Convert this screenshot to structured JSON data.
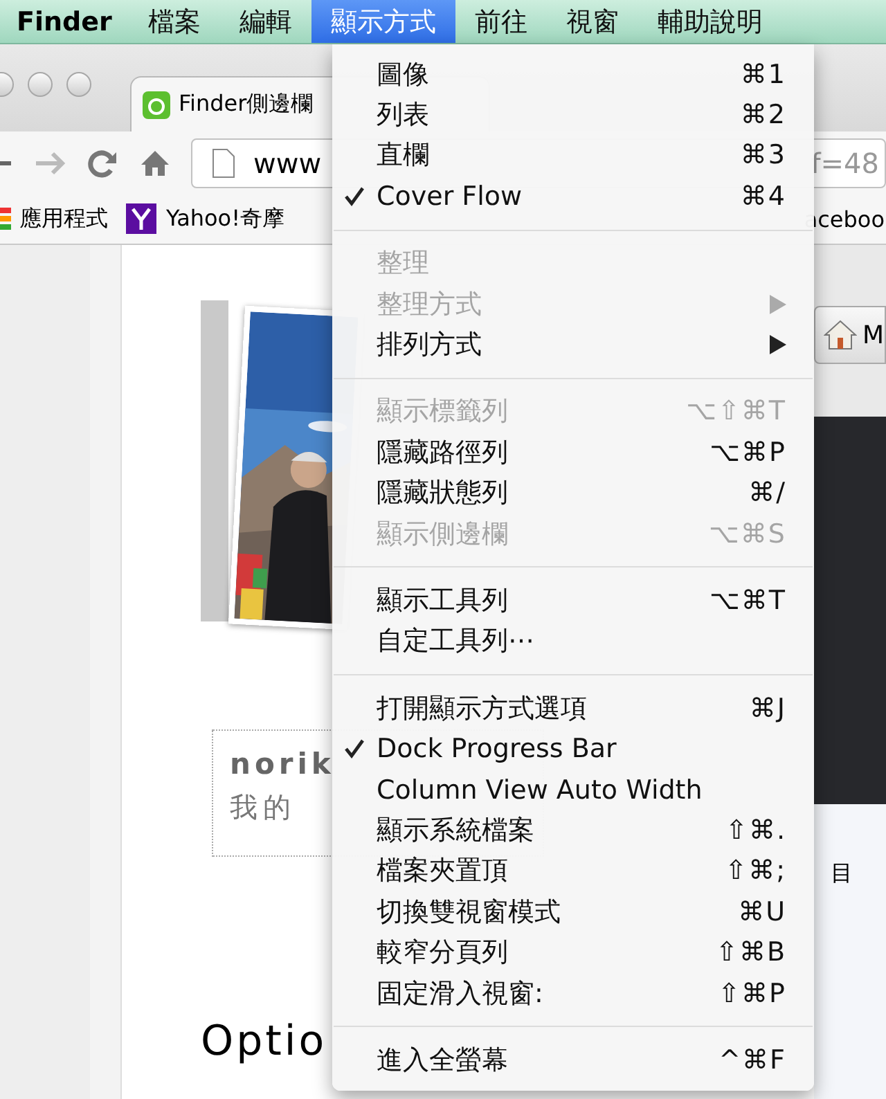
{
  "menu_bar": {
    "app_name": "Finder",
    "menus": [
      {
        "label": "檔案",
        "selected": false
      },
      {
        "label": "編輯",
        "selected": false
      },
      {
        "label": "顯示方式",
        "selected": true
      },
      {
        "label": "前往",
        "selected": false
      },
      {
        "label": "視窗",
        "selected": false
      },
      {
        "label": "輔助說明",
        "selected": false
      }
    ]
  },
  "browser": {
    "tab_title": "Finder側邊欄",
    "url": "www",
    "url_tail": "f=48",
    "bookmarks": [
      {
        "label": "應用程式",
        "kind": "apps"
      },
      {
        "label": "Yahoo!奇摩",
        "kind": "yahoo"
      }
    ],
    "bookmark_tail": "aceboo",
    "page": {
      "author": "norik",
      "caption": "我的",
      "heading": "Optio"
    },
    "side_tab": "M",
    "side_item": "目"
  },
  "dropdown": {
    "sections": [
      [
        {
          "label": "圖像",
          "shortcut": "⌘1",
          "checked": false,
          "disabled": false,
          "submenu": false
        },
        {
          "label": "列表",
          "shortcut": "⌘2",
          "checked": false,
          "disabled": false,
          "submenu": false
        },
        {
          "label": "直欄",
          "shortcut": "⌘3",
          "checked": false,
          "disabled": false,
          "submenu": false
        },
        {
          "label": "Cover Flow",
          "shortcut": "⌘4",
          "checked": true,
          "disabled": false,
          "submenu": false
        }
      ],
      [
        {
          "label": "整理",
          "checked": false,
          "disabled": true,
          "submenu": false
        },
        {
          "label": "整理方式",
          "checked": false,
          "disabled": true,
          "submenu": true
        },
        {
          "label": "排列方式",
          "checked": false,
          "disabled": false,
          "submenu": true
        }
      ],
      [
        {
          "label": "顯示標籤列",
          "shortcut": "⌥⇧⌘T",
          "checked": false,
          "disabled": true,
          "submenu": false
        },
        {
          "label": "隱藏路徑列",
          "shortcut": "⌥⌘P",
          "checked": false,
          "disabled": false,
          "submenu": false
        },
        {
          "label": "隱藏狀態列",
          "shortcut": "⌘/",
          "checked": false,
          "disabled": false,
          "submenu": false
        },
        {
          "label": "顯示側邊欄",
          "shortcut": "⌥⌘S",
          "checked": false,
          "disabled": true,
          "submenu": false
        }
      ],
      [
        {
          "label": "顯示工具列",
          "shortcut": "⌥⌘T",
          "checked": false,
          "disabled": false,
          "submenu": false
        },
        {
          "label": "自定工具列⋯",
          "checked": false,
          "disabled": false,
          "submenu": false
        }
      ],
      [
        {
          "label": "打開顯示方式選項",
          "shortcut": "⌘J",
          "checked": false,
          "disabled": false,
          "submenu": false
        },
        {
          "label": "Dock Progress Bar",
          "checked": true,
          "disabled": false,
          "submenu": false
        },
        {
          "label": "Column View Auto Width",
          "checked": false,
          "disabled": false,
          "submenu": false
        },
        {
          "label": "顯示系統檔案",
          "shortcut": "⇧⌘.",
          "checked": false,
          "disabled": false,
          "submenu": false
        },
        {
          "label": "檔案夾置頂",
          "shortcut": "⇧⌘;",
          "checked": false,
          "disabled": false,
          "submenu": false
        },
        {
          "label": "切換雙視窗模式",
          "shortcut": "⌘U",
          "checked": false,
          "disabled": false,
          "submenu": false
        },
        {
          "label": "較窄分頁列",
          "shortcut": "⇧⌘B",
          "checked": false,
          "disabled": false,
          "submenu": false
        },
        {
          "label": "固定滑入視窗:",
          "shortcut": "⇧⌘P",
          "checked": false,
          "disabled": false,
          "submenu": false
        }
      ],
      [
        {
          "label": "進入全螢幕",
          "shortcut": "^⌘F",
          "checked": false,
          "disabled": false,
          "submenu": false
        }
      ]
    ]
  }
}
